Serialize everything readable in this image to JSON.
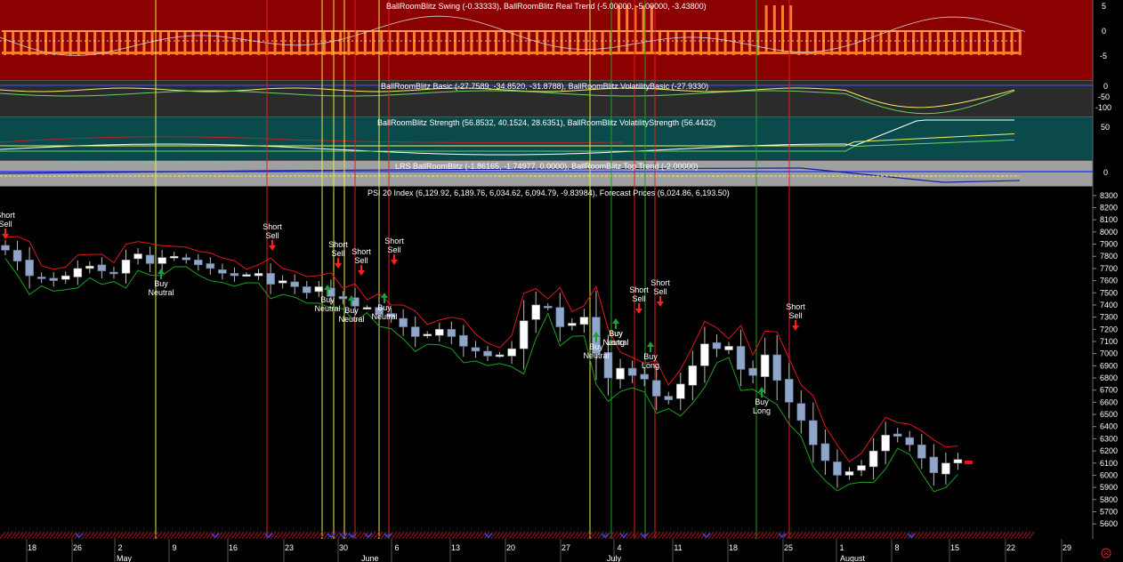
{
  "panels": {
    "swing": {
      "title": "BallRoomBlitz Swing (-0.33333), BallRoomBlitz Real Trend (-5.00000, -5.00000, -3.43800)",
      "ticks": [
        "5",
        "0",
        "-5"
      ],
      "bg": "#8b0000"
    },
    "basic": {
      "title": "BallRoomBlitz Basic (-27.7589, -34.8520, -31.8788), BallRoomBlitz VolatilityBasic (-27.9330)",
      "ticks": [
        "0",
        "-50",
        "-100"
      ],
      "bg": "#2b2b2b"
    },
    "strength": {
      "title": "BallRoomBlitz Strength (56.8532, 40.1524, 28.6351), BallRoomBlitz VolatilityStrength (56.4432)",
      "ticks": [
        "50"
      ],
      "bg": "#0b4a4a"
    },
    "lrs": {
      "title": "LRS BallRoomBlitz (-1.86165, -1.74977, 0.0000), BallRoomBlitz Top Trend (-2.00000)",
      "ticks": [
        "0"
      ],
      "bg": "#a0a0a0"
    },
    "price": {
      "title": "PSI 20 Index (6,129.92, 6,189.76, 6,034.62, 6,094.79, -9.83984), Forecast Prices (6,024.86, 6,193.50)"
    }
  },
  "x_axis": {
    "day_labels": [
      "18",
      "26",
      "2",
      "9",
      "16",
      "23",
      "30",
      "6",
      "13",
      "20",
      "27",
      "4",
      "11",
      "18",
      "25",
      "1",
      "8",
      "15",
      "22",
      "29"
    ],
    "month_labels": [
      "May",
      "June",
      "July",
      "August"
    ]
  },
  "colors": {
    "up": "#ffffff",
    "down": "#8fa6c8",
    "sell": "#ff2020",
    "buy": "#1e9e3a",
    "upper": "#e01818",
    "lower": "#1ea01e"
  },
  "chart_data": {
    "type": "candlestick",
    "title": "PSI 20 Index",
    "ylim": [
      5550,
      8350
    ],
    "yticks": [
      8300,
      8200,
      8100,
      8000,
      7900,
      7800,
      7700,
      7600,
      7500,
      7400,
      7300,
      7200,
      7100,
      7000,
      6900,
      6800,
      6700,
      6600,
      6500,
      6400,
      6300,
      6200,
      6100,
      6000,
      5900,
      5800,
      5700,
      5600
    ],
    "last": {
      "open": 6129.92,
      "high": 6189.76,
      "low": 6034.62,
      "close": 6094.79,
      "change": -9.83984
    },
    "forecast": [
      6024.86,
      6193.5
    ],
    "closes": [
      7850,
      7760,
      7640,
      7620,
      7600,
      7640,
      7700,
      7720,
      7680,
      7660,
      7770,
      7820,
      7740,
      7790,
      7800,
      7770,
      7730,
      7700,
      7660,
      7640,
      7650,
      7660,
      7570,
      7600,
      7550,
      7500,
      7550,
      7470,
      7450,
      7390,
      7380,
      7320,
      7300,
      7220,
      7140,
      7160,
      7200,
      7140,
      7060,
      7020,
      6980,
      6990,
      7040,
      7270,
      7400,
      7380,
      7220,
      7250,
      7300,
      7000,
      6800,
      6880,
      6820,
      6790,
      6650,
      6620,
      6750,
      6900,
      7080,
      7040,
      7060,
      6870,
      6820,
      6990,
      6780,
      6600,
      6450,
      6250,
      6120,
      6000,
      6030,
      6080,
      6200,
      6330,
      6320,
      6250,
      6140,
      6020,
      6100,
      6130
    ]
  },
  "signals": [
    {
      "label": "Short",
      "label2": "Sell",
      "type": "sell"
    },
    {
      "label": "Buy",
      "label2": "Neutral",
      "type": "buy"
    },
    {
      "label": "Short",
      "label2": "Sell",
      "type": "sell"
    },
    {
      "label": "Short",
      "label2": "Sell",
      "type": "sell"
    },
    {
      "label": "Buy",
      "label2": "Neutral",
      "type": "buy"
    },
    {
      "label": "Short",
      "label2": "Sell",
      "type": "sell"
    },
    {
      "label": "Buy",
      "label2": "Neutral",
      "type": "buy"
    },
    {
      "label": "Buy",
      "label2": "Neutral",
      "type": "buy"
    },
    {
      "label": "Short",
      "label2": "Sell",
      "type": "sell"
    },
    {
      "label": "Buy",
      "label2": "Neutral",
      "type": "buy"
    },
    {
      "label": "Buy",
      "label2": "Neutral",
      "type": "buy"
    },
    {
      "label": "Buy",
      "label2": "Long",
      "type": "buy"
    },
    {
      "label": "Short",
      "label2": "Sell",
      "type": "sell"
    },
    {
      "label": "Short",
      "label2": "Sell",
      "type": "sell"
    },
    {
      "label": "Buy",
      "label2": "Long",
      "type": "buy"
    },
    {
      "label": "Buy",
      "label2": "Long",
      "type": "buy"
    },
    {
      "label": "Short",
      "label2": "Sell",
      "type": "sell"
    }
  ]
}
